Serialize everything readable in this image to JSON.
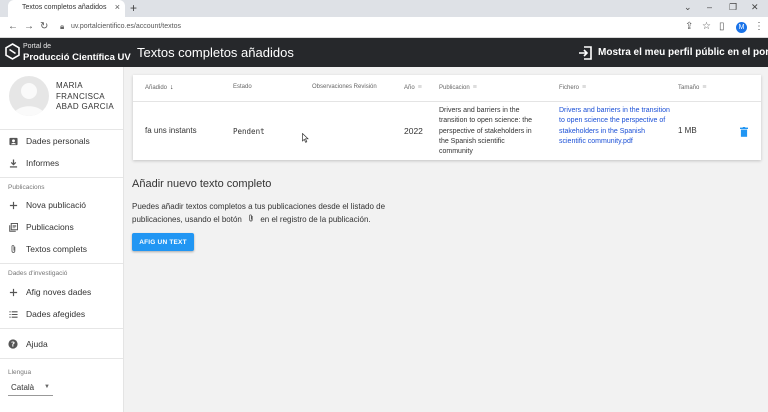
{
  "browser": {
    "tab_title": "Textos completos añadidos",
    "tab_close": "×",
    "new_tab": "+",
    "url": "uv.portalcientifico.es/account/textos",
    "profile_initial": "M"
  },
  "header": {
    "logo_line1": "Portal de",
    "logo_line2": "Producció Científica UV",
    "page_title": "Textos completos añadidos",
    "profile_link": "Mostra el meu perfil públic en el portal"
  },
  "sidebar": {
    "user_name": [
      "MARIA",
      "FRANCISCA",
      "ABAD GARCIA"
    ],
    "items_top": [
      {
        "label": "Dades personals",
        "icon": "contact-card-icon"
      },
      {
        "label": "Informes",
        "icon": "download-icon"
      }
    ],
    "section_publications": "Publicacions",
    "items_pub": [
      {
        "label": "Nova publicació",
        "icon": "plus-icon"
      },
      {
        "label": "Publicacions",
        "icon": "library-icon"
      },
      {
        "label": "Textos complets",
        "icon": "paperclip-icon"
      }
    ],
    "section_research": "Dades d'investigació",
    "items_research": [
      {
        "label": "Afig noves dades",
        "icon": "plus-icon"
      },
      {
        "label": "Dades afegides",
        "icon": "list-icon"
      }
    ],
    "help": "Ajuda",
    "language_label": "Llengua",
    "language_value": "Català"
  },
  "table": {
    "columns": [
      "Añadido",
      "Estado",
      "Observaciones Revisión",
      "Año",
      "Publicacion",
      "Fichero",
      "Tamaño"
    ],
    "rows": [
      {
        "added": "fa uns instants",
        "status": "Pendent",
        "observations": "",
        "year": "2022",
        "publication": "Drivers and barriers in the transition to open science: the perspective of stakeholders in the Spanish scientific community",
        "file": "Drivers and barriers in the transition to open science the perspective of stakeholders in the Spanish scientific community.pdf",
        "size": "1 MB"
      }
    ]
  },
  "add_section": {
    "title": "Añadir nuevo texto completo",
    "desc_line1": "Puedes añadir textos completos a tus publicaciones desde el listado de",
    "desc_line2_a": "publicaciones, usando el botón",
    "desc_line2_b": "en el registro de la publicación.",
    "button": "AFIG UN TEXT"
  },
  "colors": {
    "header_bg": "#26282b",
    "accent": "#2196f3",
    "link": "#1a4fd6"
  }
}
